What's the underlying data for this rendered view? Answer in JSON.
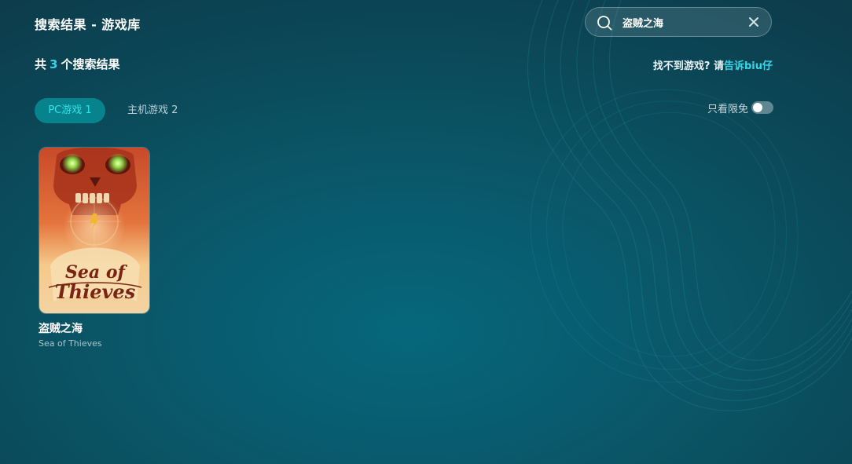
{
  "header": {
    "title": "搜索结果 - 游戏库"
  },
  "search": {
    "value": "盗贼之海"
  },
  "results": {
    "prefix": "共",
    "count": "3",
    "suffix": "个搜索结果"
  },
  "feedback": {
    "text": "找不到游戏? 请",
    "link": "告诉biu仔"
  },
  "tabs": [
    {
      "label": "PC游戏 1",
      "active": true
    },
    {
      "label": "主机游戏 2",
      "active": false
    }
  ],
  "filter": {
    "label": "只看限免",
    "enabled": false
  },
  "games": [
    {
      "name": "盗贼之海",
      "subtitle": "Sea of Thieves",
      "cover_logo_line1": "Sea of",
      "cover_logo_line2": "Thieves"
    }
  ],
  "colors": {
    "accent": "#36d6e7",
    "tab_active_bg": "#07838e"
  }
}
